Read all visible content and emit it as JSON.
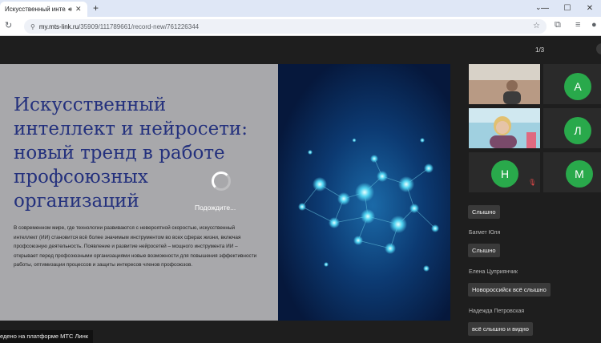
{
  "browser": {
    "tab_title": "Искусственный интеллект",
    "new_tab_label": "+",
    "url_host": "my.mts-link.ru",
    "url_path": "/35909/111789661/record-new/761226344"
  },
  "player": {
    "page_counter": "1/3",
    "loading_text": "Подождите..."
  },
  "slide": {
    "title": "Искусственный интеллект и нейросети: новый тренд в работе профсоюзных организаций",
    "body": "В современном мире, где технологии развиваются с невероятной скоростью, искусственный интеллект (ИИ) становится всё более значимым инструментом во всех сферах жизни, включая профсоюзную деятельность. Появление и развитие нейросетей – мощного инструмента ИИ – открывает перед профсоюзными организациями новые возможности для повышения эффективности работы, оптимизации процессов и защиты интересов членов профсоюзов."
  },
  "participants": [
    {
      "kind": "video"
    },
    {
      "kind": "avatar",
      "initial": "А",
      "color": "#29a94b"
    },
    {
      "kind": "video"
    },
    {
      "kind": "avatar",
      "initial": "Л",
      "color": "#29a94b"
    },
    {
      "kind": "avatar",
      "initial": "Н",
      "color": "#29a94b",
      "muted": true
    },
    {
      "kind": "avatar",
      "initial": "М",
      "color": "#29a94b"
    }
  ],
  "chat": {
    "msg1": "Слышно",
    "name2": "Багмет Юля",
    "msg2": "Слышно",
    "name3": "Елена Цуприянчик",
    "msg3": "Новороссийск всё слышно",
    "name4": "Надежда Петровская",
    "msg4": "всё слышно и видно"
  },
  "footer": {
    "label": "едено на платформе МТС Линк"
  },
  "colors": {
    "avatar_green": "#29a94b",
    "slide_title": "#24317d",
    "slide_bg": "#a8a8ab",
    "page_bg": "#1e1e1e"
  }
}
